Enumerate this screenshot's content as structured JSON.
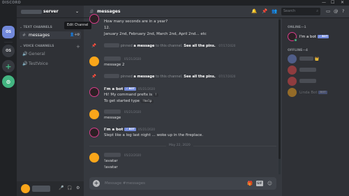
{
  "window": {
    "app_name": "DISCORD",
    "controls": [
      "—",
      "☐",
      "✕"
    ]
  },
  "guilds": [
    {
      "label": "OS",
      "active": true
    },
    {
      "label": "OS",
      "active": false
    },
    {
      "label": "+",
      "kind": "add"
    },
    {
      "label": "⊙",
      "kind": "explore"
    }
  ],
  "server": {
    "name": "server",
    "chevron": "⌄"
  },
  "channels": {
    "text_category": "⌄ TEXT CHANNELS",
    "voice_category": "⌄ VOICE CHANNELS",
    "add_symbol": "+",
    "text": [
      {
        "glyph": "#",
        "name": "messages"
      }
    ],
    "voice": [
      {
        "glyph": "🔊",
        "name": "General"
      },
      {
        "glyph": "🔊",
        "name": "TestVoice"
      }
    ],
    "tooltip": "Edit Channel",
    "controls": {
      "invite": "👤+",
      "settings": "⚙"
    }
  },
  "userbar": {
    "mic": "🎤",
    "headset": "🎧",
    "settings": "⚙"
  },
  "topbar": {
    "hash": "#",
    "channel_name": "messages",
    "icons": {
      "bell": "🔔",
      "pin": "📌",
      "members": "👥",
      "inbox": "▭",
      "mention": "@",
      "help": "?"
    },
    "search_placeholder": "Search",
    "search_icon": "⌕"
  },
  "messages": {
    "first": {
      "line1": "How many seconds are in a year?",
      "line2": "12.",
      "line3": "January 2nd, February 2nd, March 2nd, April 2nd… etc"
    },
    "pin1": {
      "pre": "pinned ",
      "bold1": "a message",
      "mid": " to this channel. ",
      "bold2": "See all the pins.",
      "time": "07/17/2020"
    },
    "msg2": {
      "time": "05/21/2020",
      "text": "message 2"
    },
    "pin2": {
      "pre": "pinned ",
      "bold1": "a message",
      "mid": " to this channel. ",
      "bold2": "See all the pins.",
      "time": "07/17/2020"
    },
    "bot1": {
      "name": "I'm a bot",
      "badge": "✓ BOT",
      "time": "05/21/2020",
      "line1": "Hi! My command prefix is",
      "prefix": "!",
      "line2": "To get started type",
      "cmd": "!help"
    },
    "msg3": {
      "time": "05/21/2020",
      "text": "message"
    },
    "bot2": {
      "name": "I'm a bot",
      "badge": "✓ BOT",
      "time": "05/21/2020",
      "text": "Slept like a log last night … woke up in the fireplace."
    },
    "date_divider": "May 22, 2020",
    "last": {
      "time": "05/22/2020",
      "line1": "!avatar",
      "line2": "!avatar"
    }
  },
  "composer": {
    "plus": "+",
    "placeholder": "Message #messages",
    "gift": "🎁",
    "gif": "GIF",
    "emoji": "☺"
  },
  "members": {
    "online_label": "ONLINE—1",
    "offline_label": "OFFLINE—4",
    "online": [
      {
        "name": "I'm a bot",
        "badge": "✓ BOT"
      }
    ],
    "offline": [
      {
        "emoji": "👑"
      },
      {},
      {},
      {
        "name": "Linda Bot",
        "badge": "BOT"
      }
    ]
  },
  "colors": {
    "accent": "#7289da",
    "online": "#43b581",
    "background": "#36393f",
    "sidebar": "#2f3136",
    "darkest": "#202225"
  }
}
